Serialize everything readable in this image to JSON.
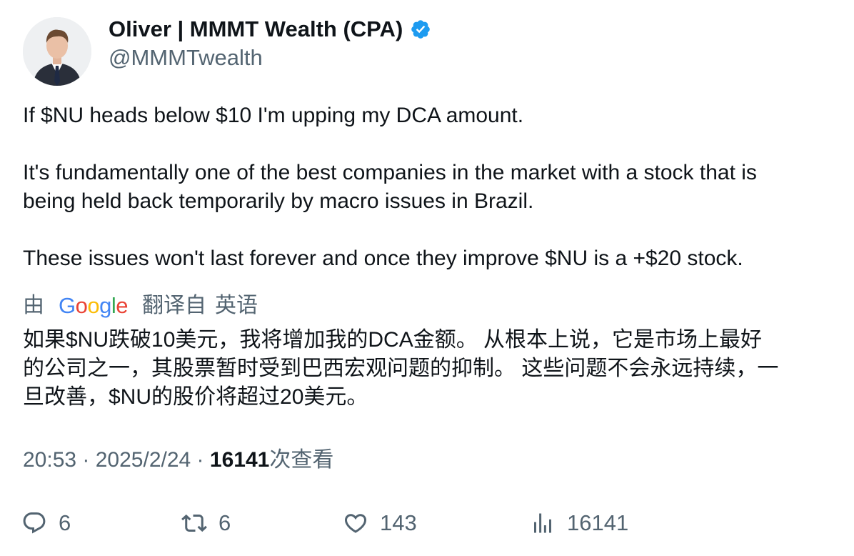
{
  "author": {
    "display_name": "Oliver | MMMT Wealth (CPA)",
    "handle": "@MMMTwealth",
    "verified": true,
    "verified_color": "#1d9bf0"
  },
  "tweet": {
    "paragraphs": [
      "If $NU heads below $10 I'm upping my DCA amount.",
      "It's fundamentally one of the best companies in the market with a stock that is",
      "being held back temporarily by macro issues in Brazil.",
      "These issues won't last forever and once they improve $NU is a +$20 stock."
    ]
  },
  "translation": {
    "by_label": "由",
    "provider": "Google",
    "translated_from": "翻译自",
    "language": "英语",
    "text": "如果$NU跌破10美元，我将增加我的DCA金额。 从根本上说，它是市场上最好\n的公司之一，其股票暂时受到巴西宏观问题的抑制。 这些问题不会永远持续，一\n旦改善，$NU的股价将超过20美元。"
  },
  "meta": {
    "time": "20:53",
    "separator": " · ",
    "date": "2025/2/24",
    "views_count": "16141",
    "views_label": "次查看"
  },
  "actions": {
    "replies": "6",
    "retweets": "6",
    "likes": "143",
    "views": "16141"
  },
  "icons": {
    "reply": "reply-icon",
    "retweet": "retweet-icon",
    "like": "heart-icon",
    "views": "bar-chart-icon",
    "verified": "verified-badge-icon"
  },
  "colors": {
    "text_primary": "#0f1419",
    "text_secondary": "#536471",
    "google_blue": "#4285F4",
    "google_red": "#EA4335",
    "google_yellow": "#FBBC05",
    "google_green": "#34A853"
  }
}
